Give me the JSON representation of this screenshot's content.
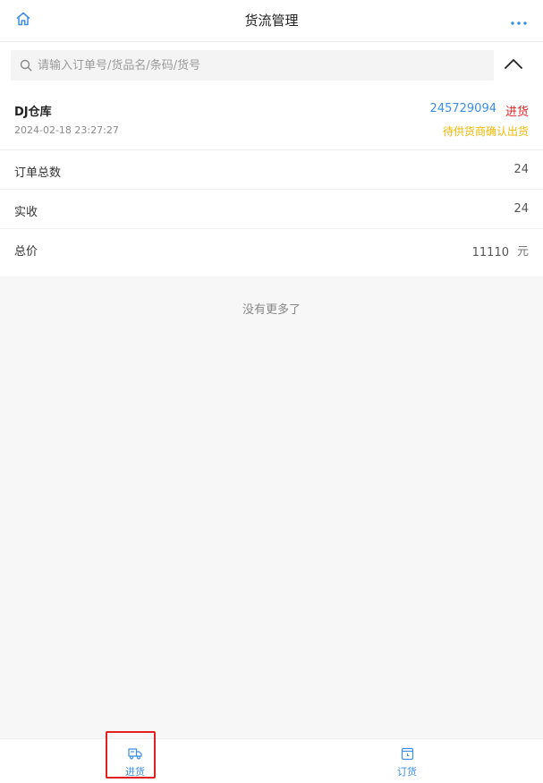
{
  "header": {
    "title": "货流管理",
    "home_icon": "home-icon",
    "more_icon": "more-dots-icon"
  },
  "search": {
    "placeholder": "请输入订单号/货品名/条码/货号",
    "value": "",
    "icon": "search-icon",
    "collapse_icon": "chevron-up-icon"
  },
  "order": {
    "warehouse": "DJ仓库",
    "datetime": "2024-02-18 23:27:27",
    "order_no": "245729094",
    "type": "进货",
    "status": "待供货商确认出货",
    "fields": [
      {
        "label": "订单总数",
        "value": "24"
      },
      {
        "label": "实收",
        "value": "24"
      }
    ],
    "total": {
      "label": "总价",
      "value": "11110",
      "unit": "元"
    }
  },
  "list_footer": "没有更多了",
  "tabbar": {
    "tabs": [
      {
        "label": "进货",
        "icon": "truck-icon",
        "active": true
      },
      {
        "label": "订货",
        "icon": "clipboard-clock-icon",
        "active": false
      }
    ]
  },
  "colors": {
    "accent": "#3a8ee6",
    "type_red": "#e02424",
    "status_yellow": "#f0b800",
    "highlight_red": "#e32020"
  }
}
